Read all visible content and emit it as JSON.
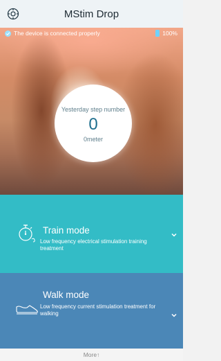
{
  "header": {
    "title": "MStim Drop",
    "settings_icon": "gear-icon"
  },
  "status": {
    "connection_text": "The device is connected properly",
    "battery": "100%"
  },
  "steps": {
    "label": "Yesterday step number",
    "value": "0",
    "distance": "0meter"
  },
  "modes": [
    {
      "name": "Train mode",
      "description": "Low frequency electrical stimulation training treatment",
      "icon": "stopwatch-icon"
    },
    {
      "name": "Walk mode",
      "description": "Low frequency current stimulation treatment for walking",
      "icon": "shoe-icon"
    }
  ],
  "footer": {
    "more_label": "More↑"
  },
  "colors": {
    "train_bg": "#33bcc6",
    "walk_bg": "#4b87b7",
    "accent": "#1f6f8e"
  }
}
